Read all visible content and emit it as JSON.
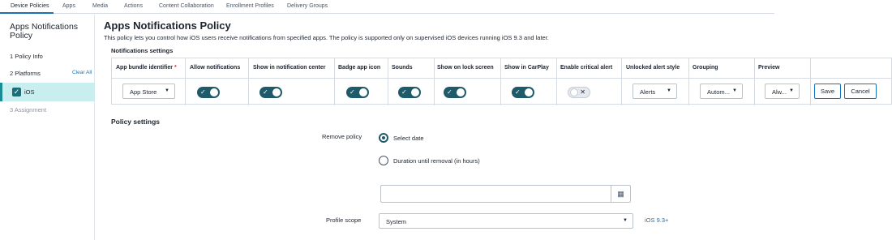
{
  "topnav": {
    "tabs": [
      "Device Policies",
      "Apps",
      "Media",
      "Actions",
      "Content Collaboration",
      "Enrollment Profiles",
      "Delivery Groups"
    ]
  },
  "sidebar": {
    "title": "Apps Notifications Policy",
    "step1": "1  Policy Info",
    "step2": "2  Platforms",
    "clear_all": "Clear All",
    "ios": "iOS",
    "step3": "3  Assignment"
  },
  "main": {
    "title": "Apps Notifications Policy",
    "description": "This policy lets you control how iOS users receive notifications from specified apps. The policy is supported only on supervised iOS devices running iOS 9.3 and later.",
    "notifications_label": "Notifications settings"
  },
  "table": {
    "headers": {
      "app_bundle": "App bundle identifier",
      "required_mark": "*",
      "allow": "Allow notifications",
      "center": "Show in notification center",
      "badge": "Badge app icon",
      "sounds": "Sounds",
      "lock": "Show on lock screen",
      "carplay": "Show in CarPlay",
      "critical": "Enable critical alert",
      "unlocked": "Unlocked alert style",
      "grouping": "Grouping",
      "preview": "Preview"
    },
    "row": {
      "app_bundle": "App Store",
      "allow": true,
      "center": true,
      "badge": true,
      "sounds": true,
      "lock": true,
      "carplay": true,
      "critical": false,
      "unlocked": "Alerts",
      "grouping": "Autom...",
      "preview": "Alw...",
      "save": "Save",
      "cancel": "Cancel"
    }
  },
  "policy": {
    "heading": "Policy settings",
    "remove_label": "Remove policy",
    "option_select_date": "Select date",
    "option_duration": "Duration until removal (in hours)",
    "selected": "Select date",
    "date_value": "",
    "scope_label": "Profile scope",
    "scope_value": "System",
    "scope_note": "iOS 9.3+"
  },
  "icons": {
    "check": "check-icon",
    "caret": "chevron-down-icon",
    "calendar": "calendar-icon",
    "toggle_x": "x-icon"
  },
  "colors": {
    "accent": "#1a73b9",
    "toggle_on": "#1e5a6a",
    "selected_bg": "#c8eef0"
  }
}
